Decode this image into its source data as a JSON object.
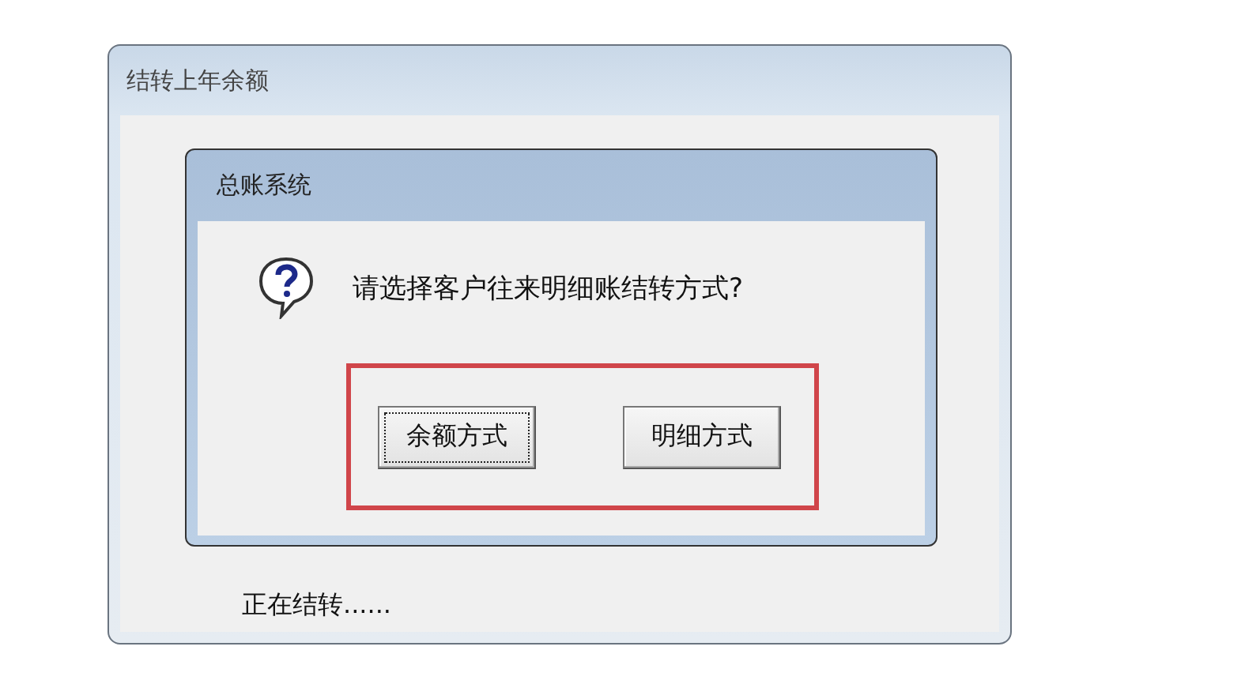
{
  "window": {
    "title": "结转上年余额"
  },
  "dialog": {
    "title": "总账系统",
    "message": "请选择客户往来明细账结转方式?",
    "highlighted": true,
    "buttons": [
      {
        "label": "余额方式",
        "focused": true
      },
      {
        "label": "明细方式",
        "focused": false
      }
    ]
  },
  "status": "正在结转......"
}
